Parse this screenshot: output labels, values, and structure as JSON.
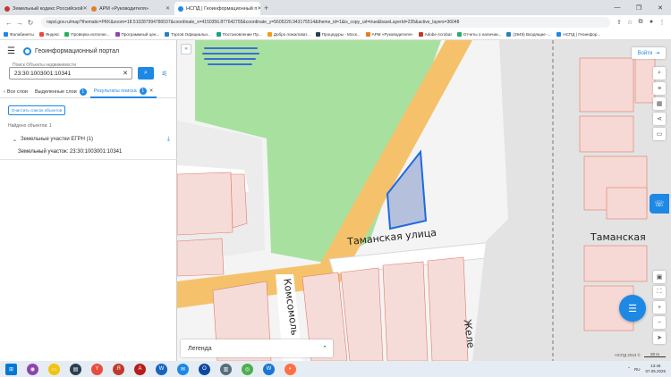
{
  "browser": {
    "tabs": [
      {
        "label": "Земельный кодекс Российской",
        "color": "#c0392b"
      },
      {
        "label": "АРМ «Руководителя»",
        "color": "#e67e22"
      },
      {
        "label": "НСПД | Геоинформационный п",
        "color": "#1e88e5",
        "active": true
      }
    ],
    "new_tab": "+",
    "url": "nspd.gov.ru/map?thematic=PKK&zoom=18.510287994780037&coordinate_x=4150356.877642755&coordinate_y=5605226.943175514&theme_id=1&is_copy_url=true&baseLayerId=235&active_layers=36048",
    "bookmarks": [
      {
        "label": "Фалабинеты",
        "color": "#1e88e5"
      },
      {
        "label": "Яндекс",
        "color": "#e74c3c"
      },
      {
        "label": "Проверка исполне...",
        "color": "#27ae60"
      },
      {
        "label": "Программный цен...",
        "color": "#8e44ad"
      },
      {
        "label": "Торгов Официальн...",
        "color": "#2980b9"
      },
      {
        "label": "Постановление Пр...",
        "color": "#16a085"
      },
      {
        "label": "Добро пожаловат...",
        "color": "#f39c12"
      },
      {
        "label": "Процедуры - Моск...",
        "color": "#2c3e50"
      },
      {
        "label": "АРМ «Руководителя»",
        "color": "#e67e22"
      },
      {
        "label": "Adobe Acrobat",
        "color": "#c0392b"
      },
      {
        "label": "Отчеты о наличии...",
        "color": "#27ae60"
      },
      {
        "label": "(2949) Входящие -...",
        "color": "#2980b9"
      },
      {
        "label": "НСПД | Геоинфор...",
        "color": "#1e88e5"
      }
    ]
  },
  "sidebar": {
    "title": "Геоинформационный портал",
    "search_label": "Поиск Объекты недвижимости",
    "search_value": "23:30:1003001:10341",
    "tabs": [
      {
        "label": "Все слои"
      },
      {
        "label": "Выделенные слои",
        "count": "1"
      },
      {
        "label": "Результаты поиска",
        "count": "1"
      }
    ],
    "clear_button": "Очистить список объектов",
    "found_text": "Найдено объектов: 1",
    "group_label": "Земельные участки ЕГРН (1)",
    "result_text": "Земельный участок: 23:30:1003001:10341"
  },
  "map": {
    "login": "Войти",
    "legend": "Легенда",
    "streets": {
      "tamanskaya_1": "Таманская  улица",
      "tamanskaya_2": "Таманская",
      "komsomolskaya": "Комсомоль",
      "zheleznaya": "Желе"
    },
    "copyright": "НСПД 2024 ©",
    "scale": "20 m"
  },
  "taskbar": {
    "lang": "RU",
    "time": "13:46",
    "date": "07.05.2025"
  }
}
